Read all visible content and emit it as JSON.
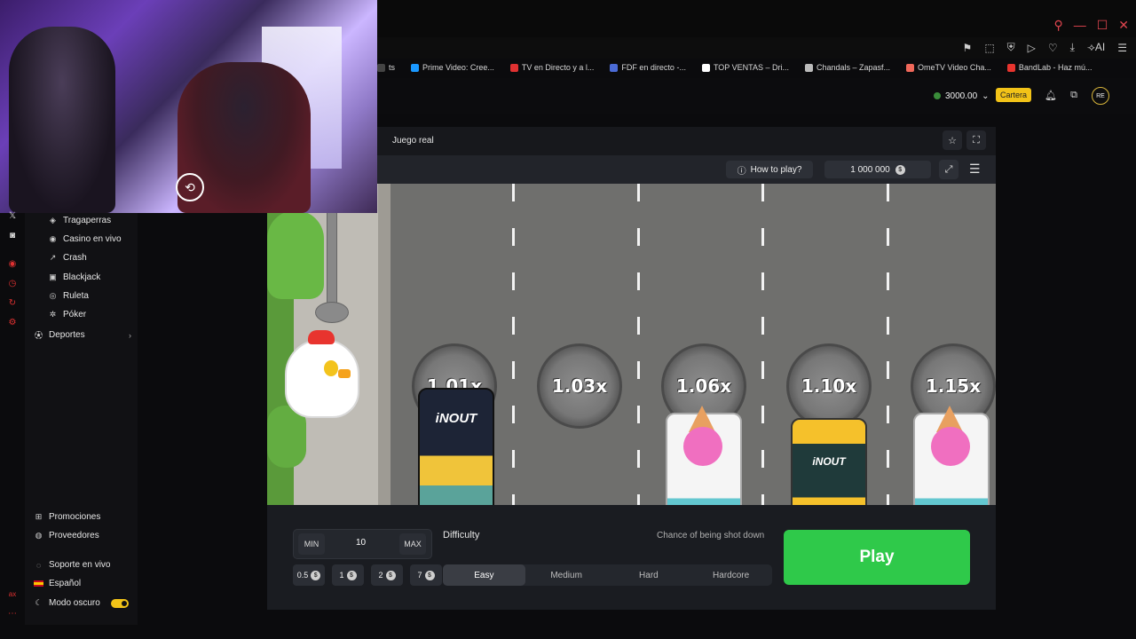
{
  "browser": {
    "bookmarks": [
      {
        "label": "ts",
        "color": "#444444"
      },
      {
        "label": "Prime Video: Cree...",
        "color": "#1a98ff"
      },
      {
        "label": "TV en Directo y a l...",
        "color": "#e03131"
      },
      {
        "label": "FDF en directo -...",
        "color": "#4b6bd6"
      },
      {
        "label": "TOP VENTAS – Dri...",
        "color": "#ffffff"
      },
      {
        "label": "Chandals – Zapasf...",
        "color": "#bbbbbb"
      },
      {
        "label": "OmeTV Video Cha...",
        "color": "#f0685a"
      },
      {
        "label": "BandLab - Haz mú...",
        "color": "#e8342e"
      }
    ],
    "toolbar_ai_label": "AI"
  },
  "header": {
    "balance": "3000.00",
    "wallet_label": "Cartera",
    "avatar": "RE"
  },
  "sidebar": {
    "items": [
      {
        "label": "Tragaperras",
        "icon": "slot-icon"
      },
      {
        "label": "Casino en vivo",
        "icon": "live-casino-icon"
      },
      {
        "label": "Crash",
        "icon": "crash-icon"
      },
      {
        "label": "Blackjack",
        "icon": "blackjack-icon"
      },
      {
        "label": "Ruleta",
        "icon": "roulette-icon"
      },
      {
        "label": "Póker",
        "icon": "poker-icon"
      },
      {
        "label": "Deportes",
        "icon": "sports-icon"
      }
    ],
    "bottom": [
      {
        "label": "Promociones",
        "icon": "promo-icon"
      },
      {
        "label": "Proveedores",
        "icon": "providers-icon"
      },
      {
        "label": "Soporte en vivo",
        "icon": "support-icon"
      },
      {
        "label": "Español",
        "icon": "spain-flag-icon"
      },
      {
        "label": "Modo oscuro",
        "icon": "moon-icon"
      }
    ]
  },
  "game": {
    "mode_label": "Juego real",
    "how_to_play": "How to play?",
    "balance": "1 000 000",
    "multipliers": [
      "1.01x",
      "1.03x",
      "1.06x",
      "1.10x",
      "1.15x"
    ],
    "truck_label": "iNOUT"
  },
  "controls": {
    "min_label": "MIN",
    "max_label": "MAX",
    "bet_value": "10",
    "quick_bets": [
      "0.5",
      "1",
      "2",
      "7"
    ],
    "difficulty_label": "Difficulty",
    "chance_label": "Chance of being shot down",
    "difficulties": [
      "Easy",
      "Medium",
      "Hard",
      "Hardcore"
    ],
    "selected_difficulty": "Easy",
    "play_label": "Play"
  }
}
